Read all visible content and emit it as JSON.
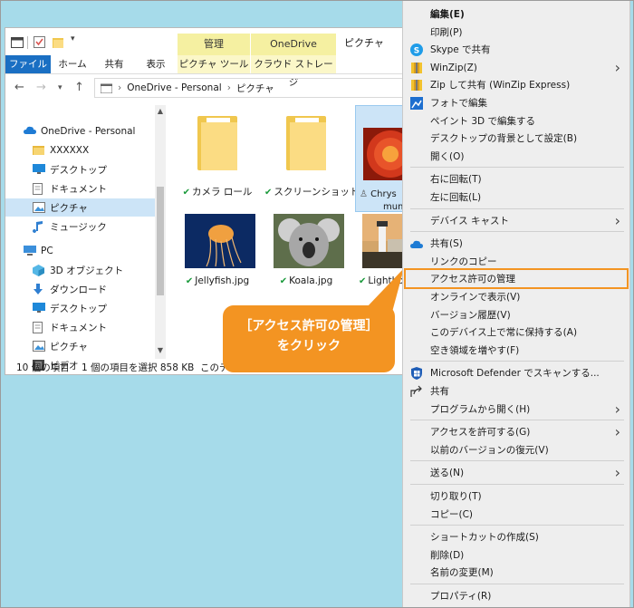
{
  "explorer": {
    "context_tabs": [
      {
        "header": "管理",
        "sub": "ピクチャ ツール"
      },
      {
        "header": "OneDrive",
        "sub": "クラウド ストレージ"
      }
    ],
    "window_title": "ピクチャ",
    "ribbon_tabs": [
      "ファイル",
      "ホーム",
      "共有",
      "表示"
    ],
    "address": {
      "root": "OneDrive - Personal",
      "folder": "ピクチャ"
    },
    "nav": [
      {
        "label": "OneDrive - Personal",
        "icon": "cloud-icon",
        "indent": 0,
        "selected": false
      },
      {
        "label": "XXXXXX",
        "icon": "folder-icon",
        "indent": 1,
        "selected": false
      },
      {
        "label": "デスクトップ",
        "icon": "desktop-icon",
        "indent": 1,
        "selected": false
      },
      {
        "label": "ドキュメント",
        "icon": "document-icon",
        "indent": 1,
        "selected": false
      },
      {
        "label": "ピクチャ",
        "icon": "pictures-icon",
        "indent": 1,
        "selected": true
      },
      {
        "label": "ミュージック",
        "icon": "music-icon",
        "indent": 1,
        "selected": false
      },
      {
        "label": "PC",
        "icon": "pc-icon",
        "indent": 0,
        "selected": false
      },
      {
        "label": "3D オブジェクト",
        "icon": "3d-objects-icon",
        "indent": 1,
        "selected": false
      },
      {
        "label": "ダウンロード",
        "icon": "download-icon",
        "indent": 1,
        "selected": false
      },
      {
        "label": "デスクトップ",
        "icon": "desktop-icon",
        "indent": 1,
        "selected": false
      },
      {
        "label": "ドキュメント",
        "icon": "document-icon",
        "indent": 1,
        "selected": false
      },
      {
        "label": "ピクチャ",
        "icon": "pictures-icon",
        "indent": 1,
        "selected": false
      },
      {
        "label": "ビデオ",
        "icon": "video-icon",
        "indent": 1,
        "selected": false
      }
    ],
    "files": [
      {
        "name": "カメラ ロール",
        "kind": "folder",
        "selected": false
      },
      {
        "name": "スクリーンショット",
        "kind": "folder",
        "selected": false
      },
      {
        "name": "Chrysanthemum",
        "name_line1": "Chrys",
        "name_line2": "mum",
        "kind": "flower",
        "selected": true
      },
      {
        "name": "Jellyfish.jpg",
        "kind": "jellyfish",
        "selected": false
      },
      {
        "name": "Koala.jpg",
        "kind": "koala",
        "selected": false
      },
      {
        "name": "Lighthou",
        "kind": "lighthouse",
        "selected": false
      }
    ],
    "status": {
      "count": "10 個の項目",
      "selection": "1 個の項目を選択  858 KB",
      "sync": "このデバ"
    }
  },
  "callout": {
    "line1": "［アクセス許可の管理］",
    "line2": "をクリック"
  },
  "menu": {
    "items": [
      {
        "label": "編集(E)",
        "bold": true
      },
      {
        "label": "印刷(P)"
      },
      {
        "label": "Skype で共有",
        "icon": "skype-icon"
      },
      {
        "label": "WinZip(Z)",
        "icon": "winzip-icon",
        "submenu": true
      },
      {
        "label": "Zip して共有 (WinZip Express)",
        "icon": "winzip-icon"
      },
      {
        "label": "フォトで編集",
        "icon": "photos-icon"
      },
      {
        "label": "ペイント 3D で編集する"
      },
      {
        "label": "デスクトップの背景として設定(B)"
      },
      {
        "label": "開く(O)"
      },
      {
        "sep": true
      },
      {
        "label": "右に回転(T)"
      },
      {
        "label": "左に回転(L)"
      },
      {
        "sep": true
      },
      {
        "label": "デバイス キャスト",
        "submenu": true
      },
      {
        "sep": true
      },
      {
        "label": "共有(S)",
        "icon": "onedrive-icon"
      },
      {
        "label": "リンクのコピー"
      },
      {
        "label": "アクセス許可の管理",
        "highlight": true
      },
      {
        "label": "オンラインで表示(V)"
      },
      {
        "label": "バージョン履歴(V)"
      },
      {
        "label": "このデバイス上で常に保持する(A)"
      },
      {
        "label": "空き領域を増やす(F)"
      },
      {
        "sep": true
      },
      {
        "label": "Microsoft Defender でスキャンする...",
        "icon": "defender-icon"
      },
      {
        "label": "共有",
        "icon": "share-icon"
      },
      {
        "label": "プログラムから開く(H)",
        "submenu": true
      },
      {
        "sep": true
      },
      {
        "label": "アクセスを許可する(G)",
        "submenu": true
      },
      {
        "label": "以前のバージョンの復元(V)"
      },
      {
        "sep": true
      },
      {
        "label": "送る(N)",
        "submenu": true
      },
      {
        "sep": true
      },
      {
        "label": "切り取り(T)"
      },
      {
        "label": "コピー(C)"
      },
      {
        "sep": true
      },
      {
        "label": "ショートカットの作成(S)"
      },
      {
        "label": "削除(D)"
      },
      {
        "label": "名前の変更(M)"
      },
      {
        "sep": true
      },
      {
        "label": "プロパティ(R)"
      }
    ]
  },
  "colors": {
    "background": "#a6dbea",
    "accent_orange": "#f39422",
    "file_tab_blue": "#1a6fc3",
    "selection": "#cce4f7"
  }
}
